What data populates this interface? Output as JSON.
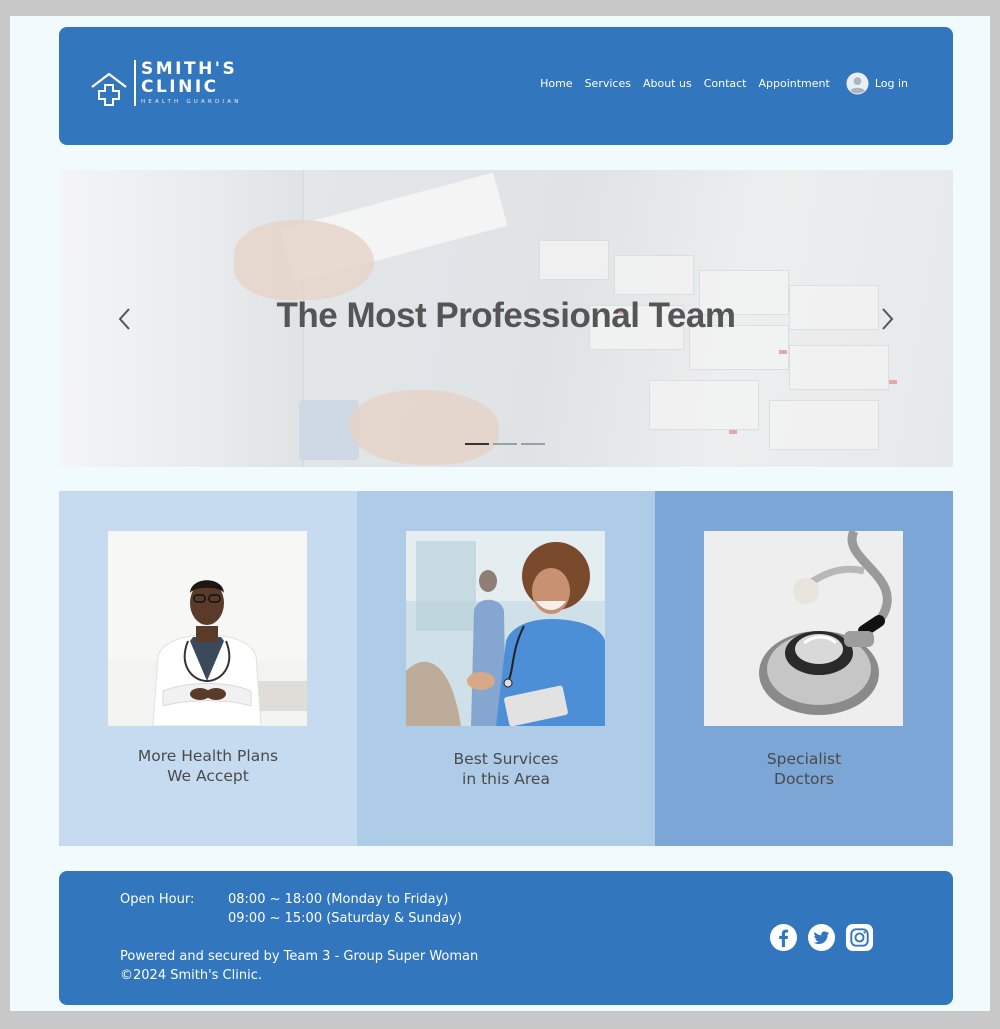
{
  "brand": {
    "line1": "SMITH'S",
    "line2": "CLINIC",
    "tagline": "HEALTH GUARDIAN",
    "icon": "medical-cross-house-icon"
  },
  "nav": {
    "items": [
      {
        "label": "Home"
      },
      {
        "label": "Services"
      },
      {
        "label": "About us"
      },
      {
        "label": "Contact"
      },
      {
        "label": "Appointment"
      }
    ],
    "login": {
      "label": "Log in",
      "icon": "user-avatar-icon"
    }
  },
  "hero": {
    "title": "The Most Professional Team",
    "prev_icon": "chevron-left-icon",
    "next_icon": "chevron-right-icon",
    "slides": 3,
    "active_slide": 1
  },
  "cards": [
    {
      "line1": "More Health Plans",
      "line2": "We Accept",
      "image": "doctor-portrait"
    },
    {
      "line1": "Best Survices",
      "line2": "in this Area",
      "image": "nurse-with-patient"
    },
    {
      "line1": "Specialist",
      "line2": "Doctors",
      "image": "stethoscope"
    }
  ],
  "footer": {
    "hours_label": "Open Hour:",
    "hours_weekday": "08:00 ~ 18:00 (Monday to Friday)",
    "hours_weekend": "09:00 ~ 15:00 (Saturday & Sunday)",
    "powered_by": "Powered and secured by Team 3 - Group Super Woman",
    "copyright": "©2024 Smith's Clinic.",
    "social": [
      "facebook-icon",
      "twitter-icon",
      "instagram-icon"
    ]
  },
  "colors": {
    "primary": "#3276be",
    "page_background": "#f1fafd",
    "card1": "#c6daf0",
    "card2": "#aecbe8",
    "card3": "#7ca6d6"
  }
}
